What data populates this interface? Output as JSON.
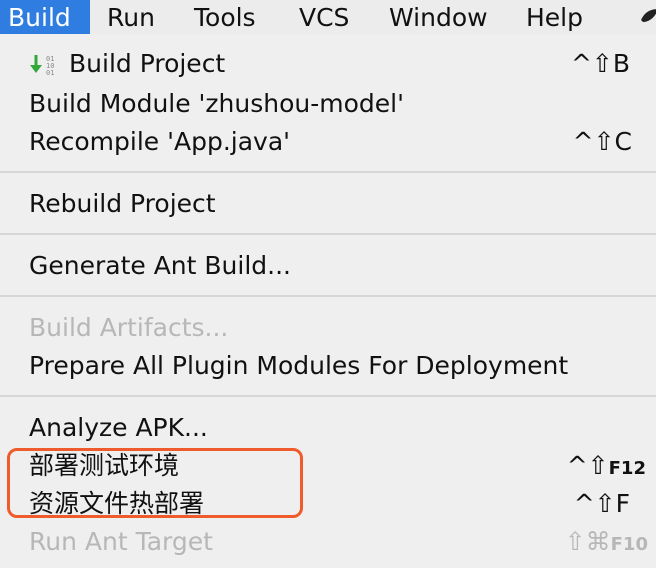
{
  "menubar": {
    "items": [
      {
        "label": "Build"
      },
      {
        "label": "Run"
      },
      {
        "label": "Tools"
      },
      {
        "label": "VCS"
      },
      {
        "label": "Window"
      },
      {
        "label": "Help"
      }
    ]
  },
  "build_menu": {
    "items": [
      {
        "label": "Build Project",
        "shortcut": "^⇧B"
      },
      {
        "label": "Build Module 'zhushou-model'",
        "shortcut": ""
      },
      {
        "label": "Recompile 'App.java'",
        "shortcut": "^⇧C"
      },
      {
        "label": "Rebuild Project",
        "shortcut": ""
      },
      {
        "label": "Generate Ant Build...",
        "shortcut": ""
      },
      {
        "label": "Build Artifacts...",
        "shortcut": "",
        "enabled": false
      },
      {
        "label": "Prepare All Plugin Modules For Deployment",
        "shortcut": ""
      },
      {
        "label": "Analyze APK...",
        "shortcut": ""
      },
      {
        "label": "部署测试环境",
        "shortcut_main": "^⇧",
        "shortcut_small": "F12"
      },
      {
        "label": "资源文件热部署",
        "shortcut": "^⇧F"
      },
      {
        "label": "Run Ant Target",
        "shortcut_main": "⇧⌘",
        "shortcut_small": "F10",
        "enabled": false
      }
    ]
  },
  "colors": {
    "active_menu": "#2f7de1",
    "highlight_box": "#ef5b2b",
    "disabled_text": "#b7b7b7"
  },
  "icons": {
    "build_project": "build-binary-down-arrow-icon",
    "menubar_trailing": "leaf-icon"
  }
}
